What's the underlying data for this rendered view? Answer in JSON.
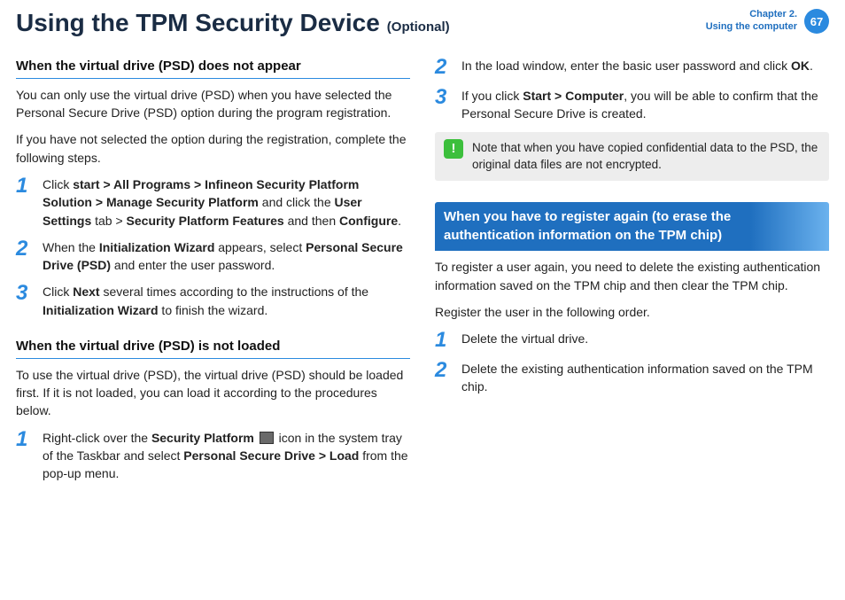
{
  "header": {
    "title": "Using the TPM Security Device",
    "suffix": "(Optional)",
    "chapter_line1": "Chapter 2.",
    "chapter_line2": "Using the computer",
    "page_number": "67"
  },
  "left": {
    "sec1_heading": "When the virtual drive (PSD) does not appear",
    "sec1_p1": "You can only use the virtual drive (PSD) when you have selected the Personal Secure Drive (PSD) option during the program registration.",
    "sec1_p2": " If you have not selected the option during the registration, complete the following steps.",
    "sec1_step1_pre": "Click ",
    "sec1_step1_b1": "start > All Programs > Infineon Security Platform Solution > Manage Security Platform",
    "sec1_step1_mid1": " and click the ",
    "sec1_step1_b2": "User Settings",
    "sec1_step1_mid2": " tab > ",
    "sec1_step1_b3": "Security Platform Features",
    "sec1_step1_mid3": " and then ",
    "sec1_step1_b4": "Configure",
    "sec1_step1_end": ".",
    "sec1_step2_pre": "When the ",
    "sec1_step2_b1": "Initialization Wizard",
    "sec1_step2_mid1": " appears, select ",
    "sec1_step2_b2": "Personal Secure Drive (PSD)",
    "sec1_step2_end": " and enter the user password.",
    "sec1_step3_pre": "Click ",
    "sec1_step3_b1": "Next",
    "sec1_step3_mid1": " several times according to the instructions of the ",
    "sec1_step3_b2": "Initialization Wizard",
    "sec1_step3_end": " to finish the wizard.",
    "sec2_heading": "When the virtual drive (PSD) is not loaded",
    "sec2_p1": "To use the virtual drive (PSD), the virtual drive (PSD) should be loaded first. If it is not loaded, you can load it according to the procedures below.",
    "sec2_step1_pre": "Right-click over the ",
    "sec2_step1_b1": "Security Platform",
    "sec2_step1_mid1": " icon in the system tray of the Taskbar and select ",
    "sec2_step1_b2": "Personal Secure Drive > Load",
    "sec2_step1_end": " from the pop-up menu."
  },
  "right": {
    "step2_pre": "In the load window, enter the basic user password and click ",
    "step2_b1": "OK",
    "step2_end": ".",
    "step3_pre": "If you click ",
    "step3_b1": "Start > Computer",
    "step3_end": ", you will be able to confirm that the Personal Secure Drive is created.",
    "note_text": "Note that when you have copied confidential data to the PSD, the original data files are not encrypted.",
    "banner": "When you have to register again (to erase the authentication information on the TPM chip)",
    "banner_p1": "To register a user again, you need to delete the existing authentication information saved on the TPM chip and then clear the TPM chip.",
    "banner_p2": "Register the user in the following order.",
    "banner_step1": "Delete the virtual drive.",
    "banner_step2": "Delete the existing authentication information saved on the TPM chip."
  },
  "nums": {
    "n1": "1",
    "n2": "2",
    "n3": "3"
  },
  "icons": {
    "alert": "!"
  }
}
